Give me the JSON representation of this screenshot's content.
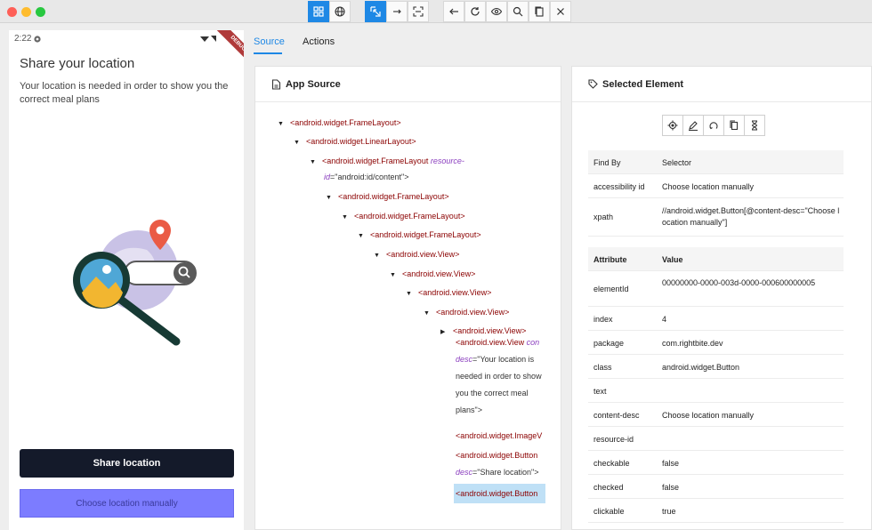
{
  "toolbar": {
    "buttons": [
      "inspector-mode-icon",
      "web-icon",
      "select-element-icon",
      "swipe-icon",
      "tap-coordinates-icon",
      "back-icon",
      "refresh-icon",
      "eye-icon",
      "search-icon",
      "copy-xml-icon",
      "quit-icon"
    ]
  },
  "device": {
    "status_time": "2:22",
    "debug_banner": "DEBUG",
    "title": "Share your location",
    "description": "Your location is needed in order to show you the correct meal plans",
    "share_button": "Share location",
    "manual_button": "Choose location manually"
  },
  "tabs": {
    "source": "Source",
    "actions": "Actions"
  },
  "source_panel": {
    "title": "App Source",
    "tree": [
      {
        "tag": "<android.widget.FrameLayout>"
      },
      {
        "tag": "<android.widget.LinearLayout>"
      },
      {
        "tag": "<android.widget.FrameLayout ",
        "attr": "resource-",
        "cont": "id",
        "val": "=\"android:id/content\">"
      },
      {
        "tag": "<android.widget.FrameLayout>"
      },
      {
        "tag": "<android.widget.FrameLayout>"
      },
      {
        "tag": "<android.widget.FrameLayout>"
      },
      {
        "tag": "<android.view.View>"
      },
      {
        "tag": "<android.view.View>"
      },
      {
        "tag": "<android.view.View>"
      },
      {
        "tag": "<android.view.View>"
      },
      {
        "tag": "<android.view.View>"
      },
      {
        "tag": "<android.view.View ",
        "attr": "con",
        "cont": "desc",
        "val": "=\"Your location is",
        "l2": "needed in order to show",
        "l3": "you the correct meal",
        "l4": "plans\">"
      },
      {
        "tag": "<android.widget.ImageV"
      },
      {
        "tag": "<android.widget.Button",
        "cont": "desc",
        "val": "=\"Share location\">"
      },
      {
        "tag": "<android.widget.Button"
      }
    ]
  },
  "element_panel": {
    "title": "Selected Element",
    "find_header": {
      "k": "Find By",
      "v": "Selector"
    },
    "find_rows": [
      {
        "k": "accessibility id",
        "v": "Choose location manually"
      },
      {
        "k": "xpath",
        "v": "//android.widget.Button[@content-desc=\"Choose location manually\"]"
      }
    ],
    "attr_header": {
      "k": "Attribute",
      "v": "Value"
    },
    "attr_rows": [
      {
        "k": "elementId",
        "v": "00000000-0000-003d-0000-000600000005"
      },
      {
        "k": "index",
        "v": "4"
      },
      {
        "k": "package",
        "v": "com.rightbite.dev"
      },
      {
        "k": "class",
        "v": "android.widget.Button"
      },
      {
        "k": "text",
        "v": ""
      },
      {
        "k": "content-desc",
        "v": "Choose location manually"
      },
      {
        "k": "resource-id",
        "v": ""
      },
      {
        "k": "checkable",
        "v": "false"
      },
      {
        "k": "checked",
        "v": "false"
      },
      {
        "k": "clickable",
        "v": "true"
      }
    ]
  }
}
